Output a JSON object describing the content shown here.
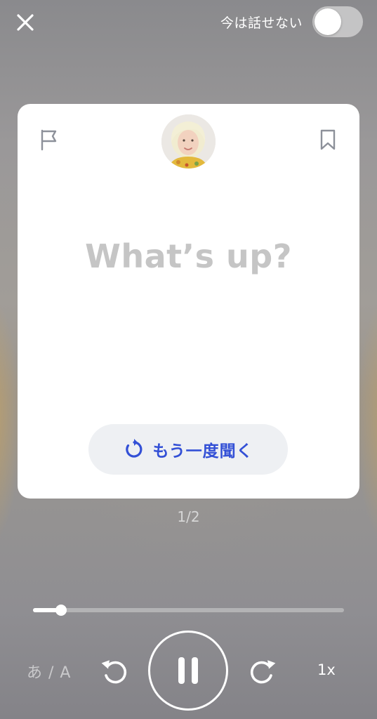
{
  "header": {
    "cant_talk_label": "今は話せない",
    "cant_talk_enabled": false
  },
  "card": {
    "phrase": "What’s up?",
    "replay_label": "もう一度聞く"
  },
  "page_indicator": "1/2",
  "player": {
    "progress": 0.09,
    "language_toggle_label": "あ / A",
    "speed_label": "1x"
  },
  "colors": {
    "accent": "#3350d6",
    "phrase_text": "#c5c5c5",
    "replay_button_bg": "#eef0f3"
  },
  "icons": [
    "close-icon",
    "flag-icon",
    "bookmark-icon",
    "avatar",
    "replay-icon",
    "rewind-icon",
    "pause-icon",
    "forward-icon"
  ]
}
